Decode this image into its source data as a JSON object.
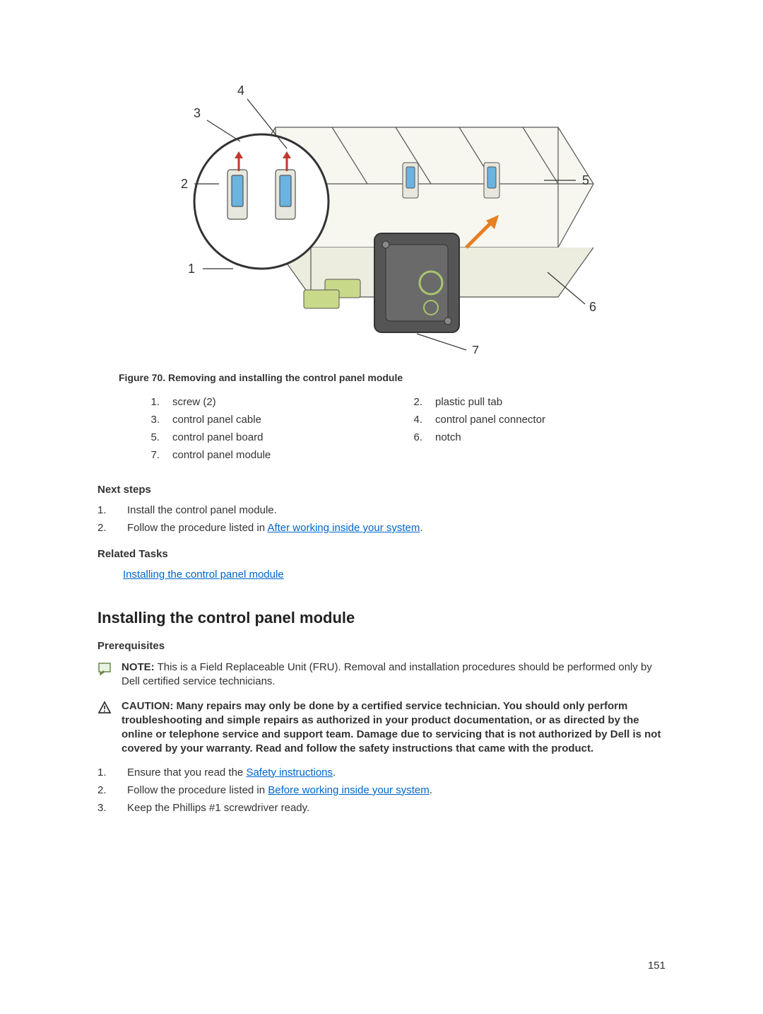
{
  "figure": {
    "caption": "Figure 70. Removing and installing the control panel module",
    "callouts": [
      "1",
      "2",
      "3",
      "4",
      "5",
      "6",
      "7"
    ],
    "legend": [
      {
        "n": "1.",
        "t": "screw (2)"
      },
      {
        "n": "2.",
        "t": "plastic pull tab"
      },
      {
        "n": "3.",
        "t": "control panel cable"
      },
      {
        "n": "4.",
        "t": "control panel connector"
      },
      {
        "n": "5.",
        "t": "control panel board"
      },
      {
        "n": "6.",
        "t": "notch"
      },
      {
        "n": "7.",
        "t": "control panel module"
      }
    ]
  },
  "next_steps": {
    "heading": "Next steps",
    "items": [
      {
        "n": "1.",
        "t": "Install the control panel module."
      },
      {
        "n": "2.",
        "pre": "Follow the procedure listed in ",
        "link": "After working inside your system",
        "post": "."
      }
    ]
  },
  "related": {
    "heading": "Related Tasks",
    "link": "Installing the control panel module"
  },
  "install": {
    "heading": "Installing the control panel module",
    "prereq_heading": "Prerequisites",
    "note": {
      "label": "NOTE:",
      "text": " This is a Field Replaceable Unit (FRU). Removal and installation procedures should be performed only by Dell certified service technicians."
    },
    "caution": {
      "label": "CAUTION:",
      "text": " Many repairs may only be done by a certified service technician. You should only perform troubleshooting and simple repairs as authorized in your product documentation, or as directed by the online or telephone service and support team. Damage due to servicing that is not authorized by Dell is not covered by your warranty. Read and follow the safety instructions that came with the product."
    },
    "items": [
      {
        "n": "1.",
        "pre": "Ensure that you read the ",
        "link": "Safety instructions",
        "post": "."
      },
      {
        "n": "2.",
        "pre": "Follow the procedure listed in ",
        "link": "Before working inside your system",
        "post": "."
      },
      {
        "n": "3.",
        "t": "Keep the Phillips #1 screwdriver ready."
      }
    ]
  },
  "page": "151"
}
